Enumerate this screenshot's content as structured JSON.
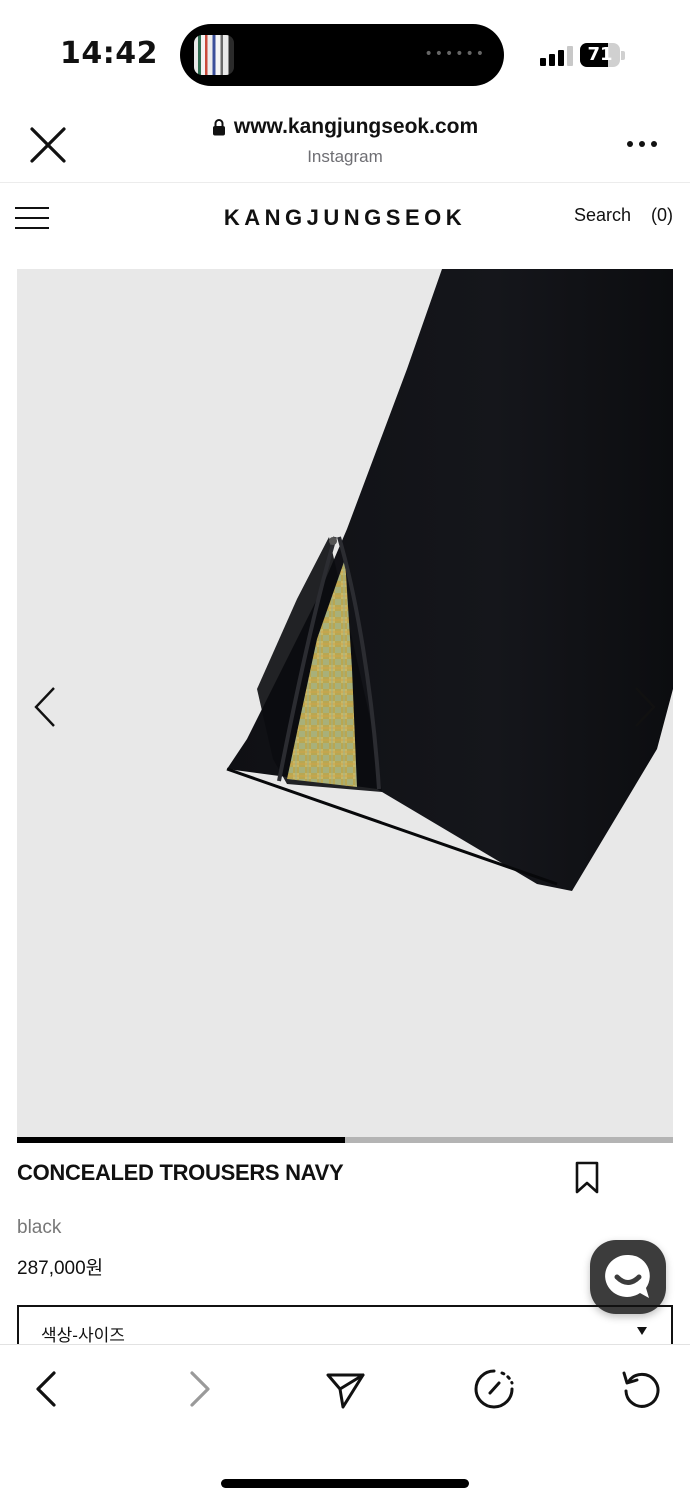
{
  "status_bar": {
    "time": "14:42",
    "battery_level": "71",
    "battery_fraction": 0.71,
    "island_dots": "••••••"
  },
  "browser": {
    "url": "www.kangjungseok.com",
    "source": "Instagram",
    "icons": [
      "close-icon",
      "lock-icon",
      "more-icon"
    ]
  },
  "site": {
    "logo": "KANGJUNGSEOK",
    "search_label": "Search",
    "cart_count": "(0)"
  },
  "gallery": {
    "progress_fraction": 0.5,
    "icons": [
      "chevron-left-icon",
      "chevron-right-icon"
    ],
    "background_color": "#e8e8e8"
  },
  "product": {
    "name": "CONCEALED TROUSERS NAVY",
    "color": "black",
    "price": "287,000원",
    "option_select": "색상-사이즈"
  },
  "toolbar": {
    "icons": [
      "back-icon",
      "forward-icon",
      "share-icon",
      "speed-icon",
      "reload-icon"
    ]
  },
  "colors": {
    "accent": "#000000",
    "muted_text": "#777777",
    "chat_bg": "#3c3c3c"
  }
}
